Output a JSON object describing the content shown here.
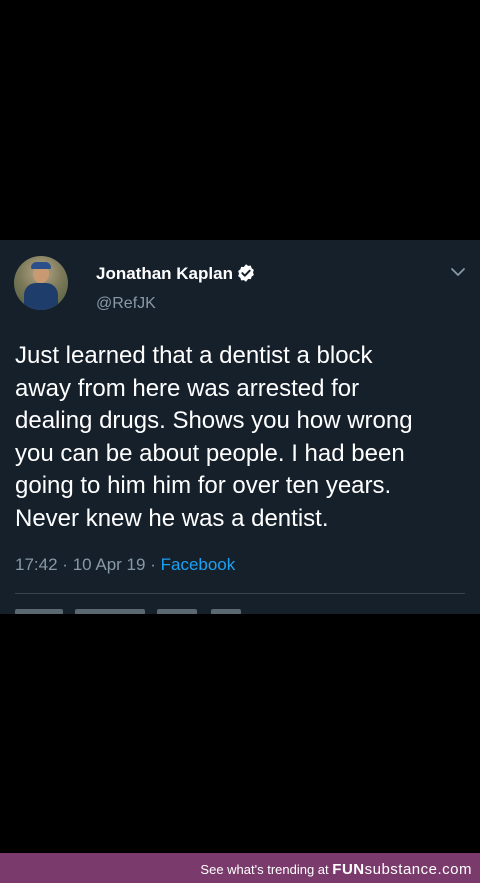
{
  "tweet": {
    "author": {
      "display_name": "Jonathan Kaplan",
      "handle": "@RefJK",
      "verified": true
    },
    "text_lines": [
      "Just learned that a dentist a block",
      "away from here was arrested for",
      "dealing drugs. Shows you how wrong",
      "you can be about people. I had been",
      "going to him him for over ten years.",
      "Never knew he was a dentist."
    ],
    "time": "17:42",
    "date": "10 Apr 19",
    "separator": "·",
    "source": "Facebook",
    "icons": {
      "verified": "verified-badge-icon",
      "menu": "chevron-down-icon"
    }
  },
  "footer": {
    "text": "See what's trending at",
    "brand_fun": "FUN",
    "brand_substance": "substance.com"
  },
  "colors": {
    "card_bg": "#15202b",
    "text": "#ffffff",
    "muted": "#8899a6",
    "link": "#1da1f2",
    "footer_bg": "#7a3a6b"
  }
}
